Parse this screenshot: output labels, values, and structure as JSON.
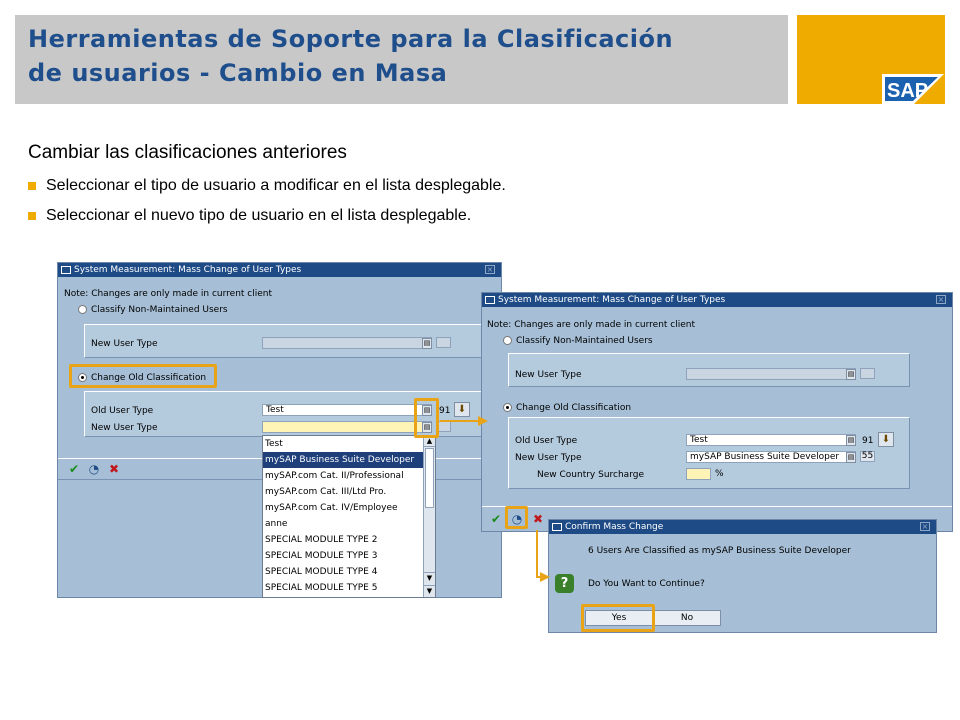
{
  "header": {
    "title_line1": "Herramientas de Soporte para la Clasificación",
    "title_line2": "de usuarios - Cambio en Masa",
    "logo_text": "SAP"
  },
  "content": {
    "subtitle": "Cambiar las clasificaciones anteriores",
    "bullets": [
      "Seleccionar el tipo de usuario a modificar en el lista desplegable.",
      "Seleccionar el nuevo tipo de usuario en el lista desplegable."
    ]
  },
  "dialog1": {
    "title": "System Measurement: Mass Change of User Types",
    "note": "Note: Changes are only made in current client",
    "radio_classify": "Classify Non-Maintained Users",
    "new_user_type_label": "New User Type",
    "radio_change_old": "Change Old Classification",
    "old_user_type_label": "Old User Type",
    "old_user_type_value": "Test",
    "old_user_type_code": "91",
    "new_user_type_label2": "New User Type",
    "dropdown_items": [
      "Test",
      "mySAP Business Suite Developer",
      "mySAP.com Cat. II/Professional",
      "mySAP.com Cat. III/Ltd Pro.",
      "mySAP.com Cat. IV/Employee",
      "anne",
      "SPECIAL MODULE TYPE 2",
      "SPECIAL MODULE TYPE 3",
      "SPECIAL MODULE TYPE 4",
      "SPECIAL MODULE TYPE 5"
    ],
    "dropdown_selected_index": 1
  },
  "dialog2": {
    "title": "System Measurement: Mass Change of User Types",
    "note": "Note: Changes are only made in current client",
    "radio_classify": "Classify Non-Maintained Users",
    "new_user_type_label": "New User Type",
    "radio_change_old": "Change Old Classification",
    "old_user_type_label": "Old User Type",
    "old_user_type_value": "Test",
    "old_user_type_code": "91",
    "new_user_type_label2": "New User Type",
    "new_user_type_value": "mySAP Business Suite Developer",
    "new_user_type_code": "55",
    "surcharge_label": "New Country Surcharge",
    "surcharge_unit": "%"
  },
  "dialog3": {
    "title": "Confirm Mass Change",
    "message": "6 Users Are Classified as mySAP Business Suite Developer",
    "question": "Do You Want to Continue?",
    "yes_label": "Yes",
    "no_label": "No",
    "question_icon": "?"
  },
  "icons": {
    "execute": "✔",
    "schedule": "◔",
    "cancel": "✖",
    "dropdown": "▤"
  },
  "colors": {
    "header_gray": "#c8c8c8",
    "title_blue": "#1f4e8c",
    "sap_gold": "#f0ab00",
    "highlight": "#e8a317",
    "dialog_bg": "#a6bfd6",
    "titlebar": "#1e4b86"
  }
}
